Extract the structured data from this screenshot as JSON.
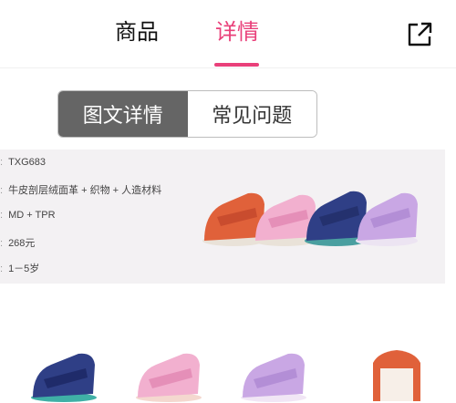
{
  "header": {
    "tab_goods": "商品",
    "tab_detail": "详情",
    "share_icon": "share-external-icon",
    "accent": "#e9407a"
  },
  "segment": {
    "option_1": "图文详情",
    "option_2": "常见问题",
    "active_color": "#656565"
  },
  "specs": [
    "TXG683",
    "牛皮剖层绒面革 + 织物 + 人造材料",
    "MD + TPR",
    "268元",
    "1－5岁"
  ]
}
